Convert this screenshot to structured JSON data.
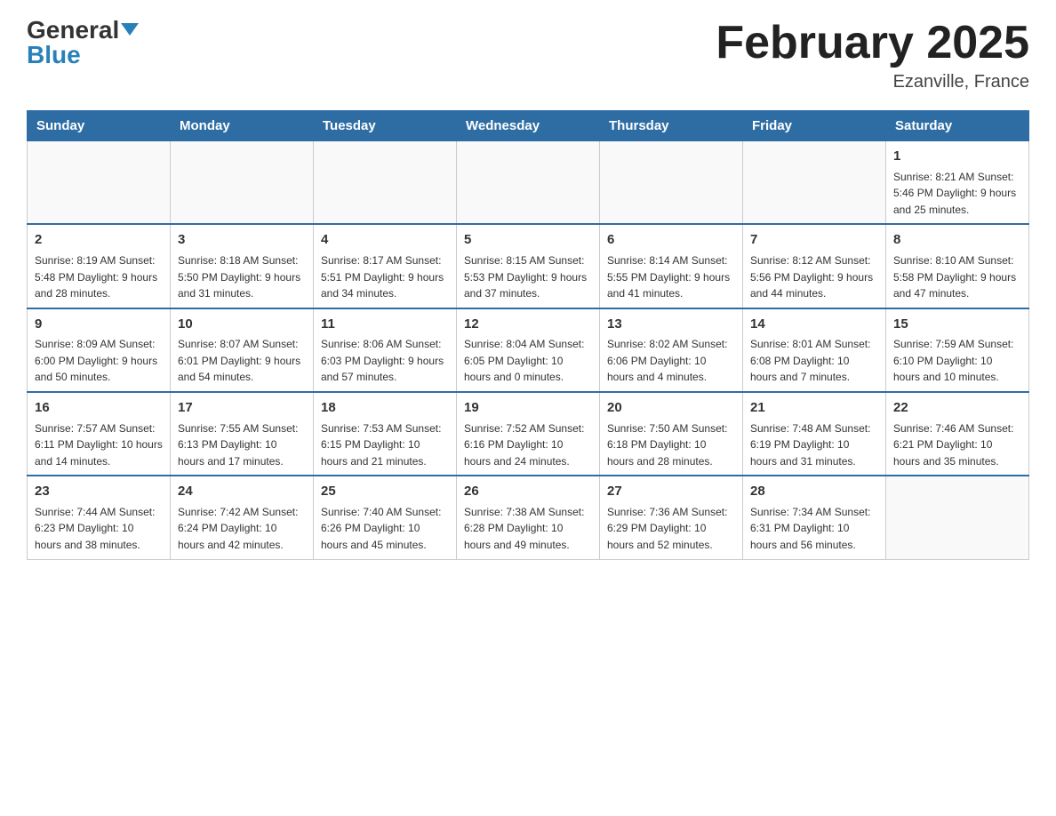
{
  "header": {
    "logo_general": "General",
    "logo_blue": "Blue",
    "month_title": "February 2025",
    "location": "Ezanville, France"
  },
  "weekdays": [
    "Sunday",
    "Monday",
    "Tuesday",
    "Wednesday",
    "Thursday",
    "Friday",
    "Saturday"
  ],
  "weeks": [
    [
      {
        "day": "",
        "info": ""
      },
      {
        "day": "",
        "info": ""
      },
      {
        "day": "",
        "info": ""
      },
      {
        "day": "",
        "info": ""
      },
      {
        "day": "",
        "info": ""
      },
      {
        "day": "",
        "info": ""
      },
      {
        "day": "1",
        "info": "Sunrise: 8:21 AM\nSunset: 5:46 PM\nDaylight: 9 hours\nand 25 minutes."
      }
    ],
    [
      {
        "day": "2",
        "info": "Sunrise: 8:19 AM\nSunset: 5:48 PM\nDaylight: 9 hours\nand 28 minutes."
      },
      {
        "day": "3",
        "info": "Sunrise: 8:18 AM\nSunset: 5:50 PM\nDaylight: 9 hours\nand 31 minutes."
      },
      {
        "day": "4",
        "info": "Sunrise: 8:17 AM\nSunset: 5:51 PM\nDaylight: 9 hours\nand 34 minutes."
      },
      {
        "day": "5",
        "info": "Sunrise: 8:15 AM\nSunset: 5:53 PM\nDaylight: 9 hours\nand 37 minutes."
      },
      {
        "day": "6",
        "info": "Sunrise: 8:14 AM\nSunset: 5:55 PM\nDaylight: 9 hours\nand 41 minutes."
      },
      {
        "day": "7",
        "info": "Sunrise: 8:12 AM\nSunset: 5:56 PM\nDaylight: 9 hours\nand 44 minutes."
      },
      {
        "day": "8",
        "info": "Sunrise: 8:10 AM\nSunset: 5:58 PM\nDaylight: 9 hours\nand 47 minutes."
      }
    ],
    [
      {
        "day": "9",
        "info": "Sunrise: 8:09 AM\nSunset: 6:00 PM\nDaylight: 9 hours\nand 50 minutes."
      },
      {
        "day": "10",
        "info": "Sunrise: 8:07 AM\nSunset: 6:01 PM\nDaylight: 9 hours\nand 54 minutes."
      },
      {
        "day": "11",
        "info": "Sunrise: 8:06 AM\nSunset: 6:03 PM\nDaylight: 9 hours\nand 57 minutes."
      },
      {
        "day": "12",
        "info": "Sunrise: 8:04 AM\nSunset: 6:05 PM\nDaylight: 10 hours\nand 0 minutes."
      },
      {
        "day": "13",
        "info": "Sunrise: 8:02 AM\nSunset: 6:06 PM\nDaylight: 10 hours\nand 4 minutes."
      },
      {
        "day": "14",
        "info": "Sunrise: 8:01 AM\nSunset: 6:08 PM\nDaylight: 10 hours\nand 7 minutes."
      },
      {
        "day": "15",
        "info": "Sunrise: 7:59 AM\nSunset: 6:10 PM\nDaylight: 10 hours\nand 10 minutes."
      }
    ],
    [
      {
        "day": "16",
        "info": "Sunrise: 7:57 AM\nSunset: 6:11 PM\nDaylight: 10 hours\nand 14 minutes."
      },
      {
        "day": "17",
        "info": "Sunrise: 7:55 AM\nSunset: 6:13 PM\nDaylight: 10 hours\nand 17 minutes."
      },
      {
        "day": "18",
        "info": "Sunrise: 7:53 AM\nSunset: 6:15 PM\nDaylight: 10 hours\nand 21 minutes."
      },
      {
        "day": "19",
        "info": "Sunrise: 7:52 AM\nSunset: 6:16 PM\nDaylight: 10 hours\nand 24 minutes."
      },
      {
        "day": "20",
        "info": "Sunrise: 7:50 AM\nSunset: 6:18 PM\nDaylight: 10 hours\nand 28 minutes."
      },
      {
        "day": "21",
        "info": "Sunrise: 7:48 AM\nSunset: 6:19 PM\nDaylight: 10 hours\nand 31 minutes."
      },
      {
        "day": "22",
        "info": "Sunrise: 7:46 AM\nSunset: 6:21 PM\nDaylight: 10 hours\nand 35 minutes."
      }
    ],
    [
      {
        "day": "23",
        "info": "Sunrise: 7:44 AM\nSunset: 6:23 PM\nDaylight: 10 hours\nand 38 minutes."
      },
      {
        "day": "24",
        "info": "Sunrise: 7:42 AM\nSunset: 6:24 PM\nDaylight: 10 hours\nand 42 minutes."
      },
      {
        "day": "25",
        "info": "Sunrise: 7:40 AM\nSunset: 6:26 PM\nDaylight: 10 hours\nand 45 minutes."
      },
      {
        "day": "26",
        "info": "Sunrise: 7:38 AM\nSunset: 6:28 PM\nDaylight: 10 hours\nand 49 minutes."
      },
      {
        "day": "27",
        "info": "Sunrise: 7:36 AM\nSunset: 6:29 PM\nDaylight: 10 hours\nand 52 minutes."
      },
      {
        "day": "28",
        "info": "Sunrise: 7:34 AM\nSunset: 6:31 PM\nDaylight: 10 hours\nand 56 minutes."
      },
      {
        "day": "",
        "info": ""
      }
    ]
  ]
}
